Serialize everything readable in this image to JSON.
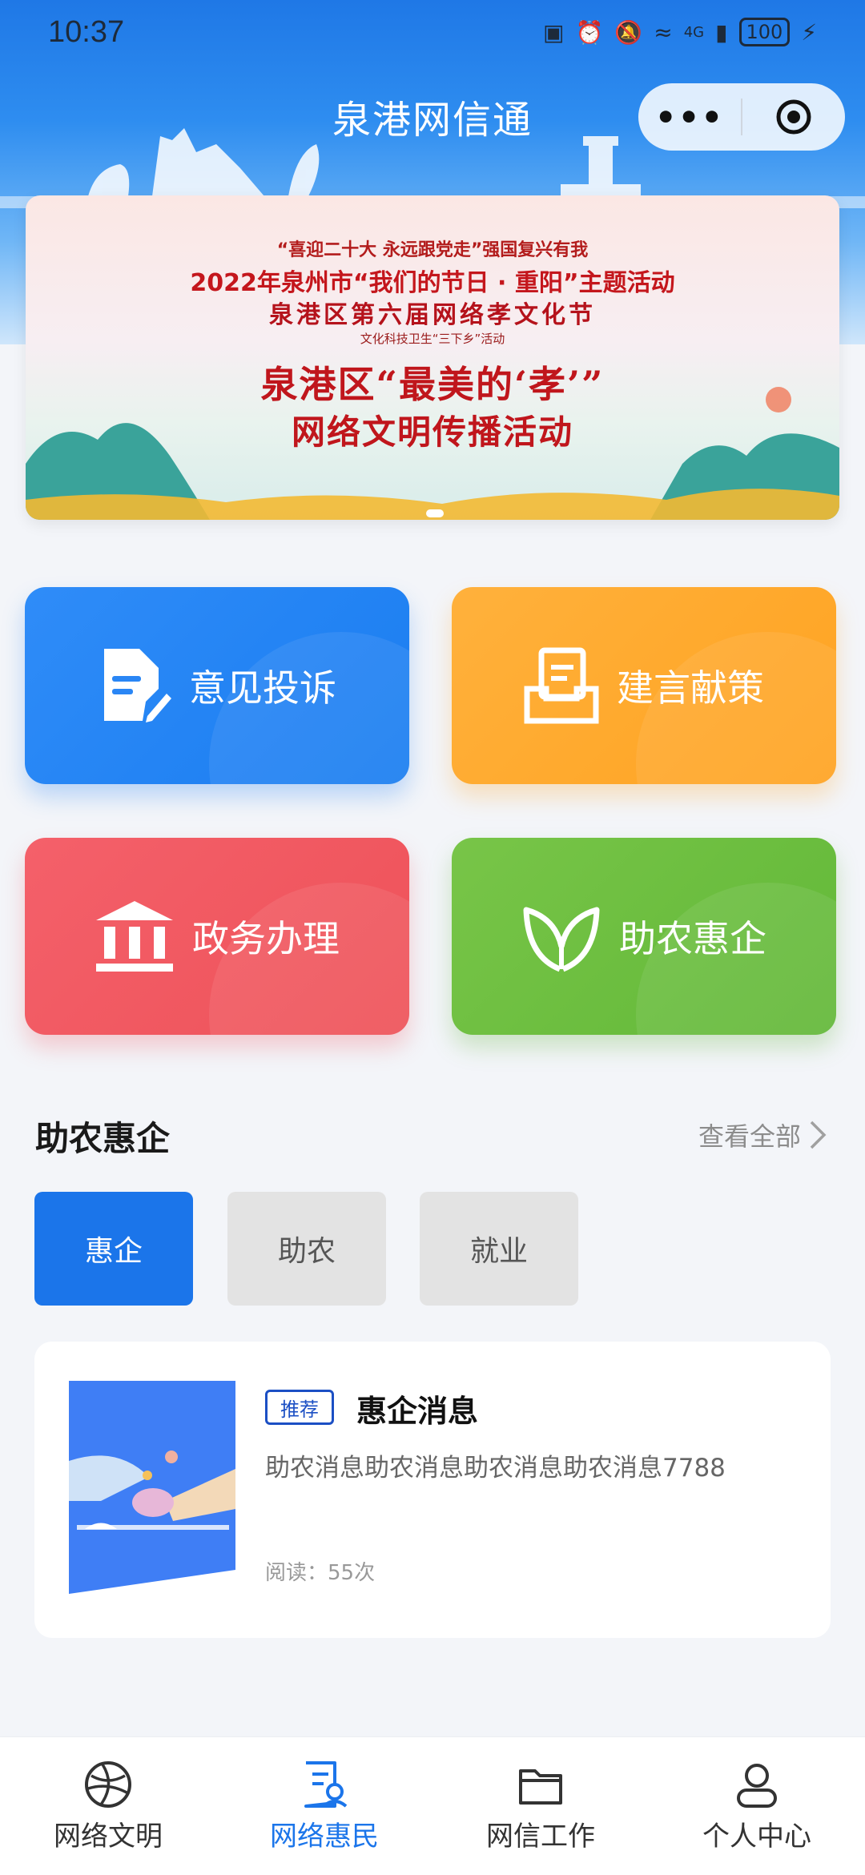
{
  "status_bar": {
    "time": "10:37",
    "battery": "100",
    "network": "4G",
    "icons": [
      "sim-icon",
      "nfc-icon",
      "alarm-icon",
      "mute-icon",
      "wifi-icon",
      "signal-icon",
      "battery-icon",
      "charging-icon"
    ]
  },
  "header": {
    "title": "泉港网信通",
    "more_label": "•••",
    "accent_color": "#1b75ea"
  },
  "banner": {
    "line1": "“喜迎二十大 永远跟党走”强国复兴有我",
    "line2": "2022年泉州市“我们的节日 · 重阳”主题活动",
    "line3": "泉港区第六届网络孝文化节",
    "line4": "文化科技卫生“三下乡”活动",
    "line5": "泉港区“最美的‘孝’”",
    "line6": "网络文明传播活动"
  },
  "tiles": [
    {
      "label": "意见投诉",
      "icon": "document-edit-icon",
      "color": "#1f86f5"
    },
    {
      "label": "建言献策",
      "icon": "inbox-document-icon",
      "color": "#ffab2e"
    },
    {
      "label": "政务办理",
      "icon": "government-building-icon",
      "color": "#f05a62"
    },
    {
      "label": "助农惠企",
      "icon": "leaf-icon",
      "color": "#6cbd40"
    }
  ],
  "section": {
    "title": "助农惠企",
    "view_all": "查看全部"
  },
  "filters": [
    {
      "label": "惠企",
      "active": true
    },
    {
      "label": "助农",
      "active": false
    },
    {
      "label": "就业",
      "active": false
    }
  ],
  "article": {
    "tag": "推荐",
    "title": "惠企消息",
    "description": "助农消息助农消息助农消息助农消息7788",
    "reads": "阅读：55次"
  },
  "tabbar": [
    {
      "label": "网络文明",
      "icon": "globe-icon",
      "active": false
    },
    {
      "label": "网络惠民",
      "icon": "document-person-icon",
      "active": true
    },
    {
      "label": "网信工作",
      "icon": "folder-icon",
      "active": false
    },
    {
      "label": "个人中心",
      "icon": "user-icon",
      "active": false
    }
  ]
}
